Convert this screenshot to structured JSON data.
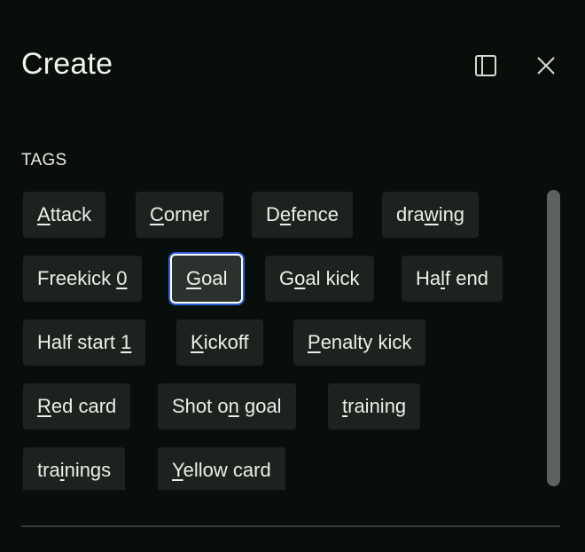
{
  "dialog": {
    "title": "Create",
    "panel_icon": "sidebar-panel-icon",
    "close_icon": "close-icon"
  },
  "tags_section": {
    "label": "TAGS",
    "selected_tag": "Goal",
    "tags": [
      {
        "pre": "",
        "key": "A",
        "post": "ttack"
      },
      {
        "pre": "",
        "key": "C",
        "post": "orner"
      },
      {
        "pre": "D",
        "key": "e",
        "post": "fence"
      },
      {
        "pre": "dra",
        "key": "w",
        "post": "ing"
      },
      {
        "pre": "Freekick ",
        "key": "0",
        "post": ""
      },
      {
        "pre": "",
        "key": "G",
        "post": "oal"
      },
      {
        "pre": "G",
        "key": "o",
        "post": "al kick"
      },
      {
        "pre": "Ha",
        "key": "l",
        "post": "f end"
      },
      {
        "pre": "Half start ",
        "key": "1",
        "post": ""
      },
      {
        "pre": "",
        "key": "K",
        "post": "ickoff"
      },
      {
        "pre": "",
        "key": "P",
        "post": "enalty kick"
      },
      {
        "pre": "",
        "key": "R",
        "post": "ed card"
      },
      {
        "pre": "Shot o",
        "key": "n",
        "post": " goal"
      },
      {
        "pre": "",
        "key": "t",
        "post": "raining"
      },
      {
        "pre": "tra",
        "key": "i",
        "post": "nings"
      },
      {
        "pre": "",
        "key": "Y",
        "post": "ellow card"
      }
    ]
  },
  "colors": {
    "background": "#080f0a",
    "tag_background": "#1d221f",
    "focus_ring": "#2f5fd6",
    "scrollbar": "#5c625e"
  }
}
